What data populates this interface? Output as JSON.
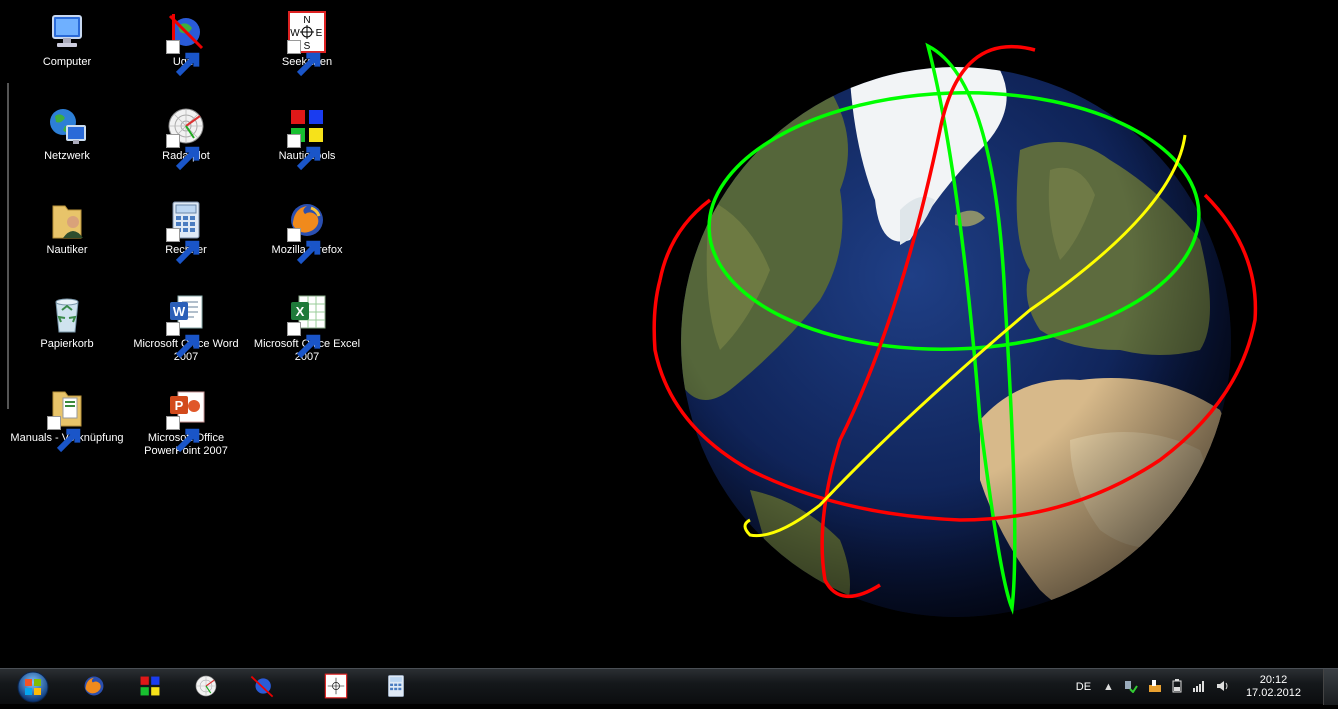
{
  "desktop": {
    "icons": [
      {
        "label": "Computer",
        "icon": "computer-icon"
      },
      {
        "label": "Ugrib",
        "icon": "ugrib-icon"
      },
      {
        "label": "Seekarten",
        "icon": "seekarten-icon"
      },
      {
        "label": "Netzwerk",
        "icon": "network-icon"
      },
      {
        "label": "Radarplot",
        "icon": "radarplot-icon"
      },
      {
        "label": "NauticTools",
        "icon": "nautictools-icon"
      },
      {
        "label": "Nautiker",
        "icon": "user-folder-icon"
      },
      {
        "label": "Rechner",
        "icon": "calculator-icon"
      },
      {
        "label": "Mozilla Firefox",
        "icon": "firefox-icon"
      },
      {
        "label": "Papierkorb",
        "icon": "recycle-bin-icon"
      },
      {
        "label": "Microsoft Office Word 2007",
        "icon": "word-icon"
      },
      {
        "label": "Microsoft Office Excel 2007",
        "icon": "excel-icon"
      },
      {
        "label": "Manuals - Verknüpfung",
        "icon": "folder-shortcut-icon"
      },
      {
        "label": "Microsoft Office PowerPoint 2007",
        "icon": "powerpoint-icon"
      }
    ],
    "wallpaper": "satellite-orbits-globe",
    "orbit_colors": [
      "#00ff00",
      "#ff0000",
      "#ffff00"
    ]
  },
  "taskbar": {
    "start": "windows-start-icon",
    "pinned": [
      "firefox-icon",
      "nautictools-icon",
      "radarplot-icon",
      "ugrib-icon",
      "seekarten-icon",
      "calculator-icon"
    ],
    "tray": {
      "language": "DE",
      "show_hidden": "▲",
      "time": "20:12",
      "date": "17.02.2012"
    }
  }
}
